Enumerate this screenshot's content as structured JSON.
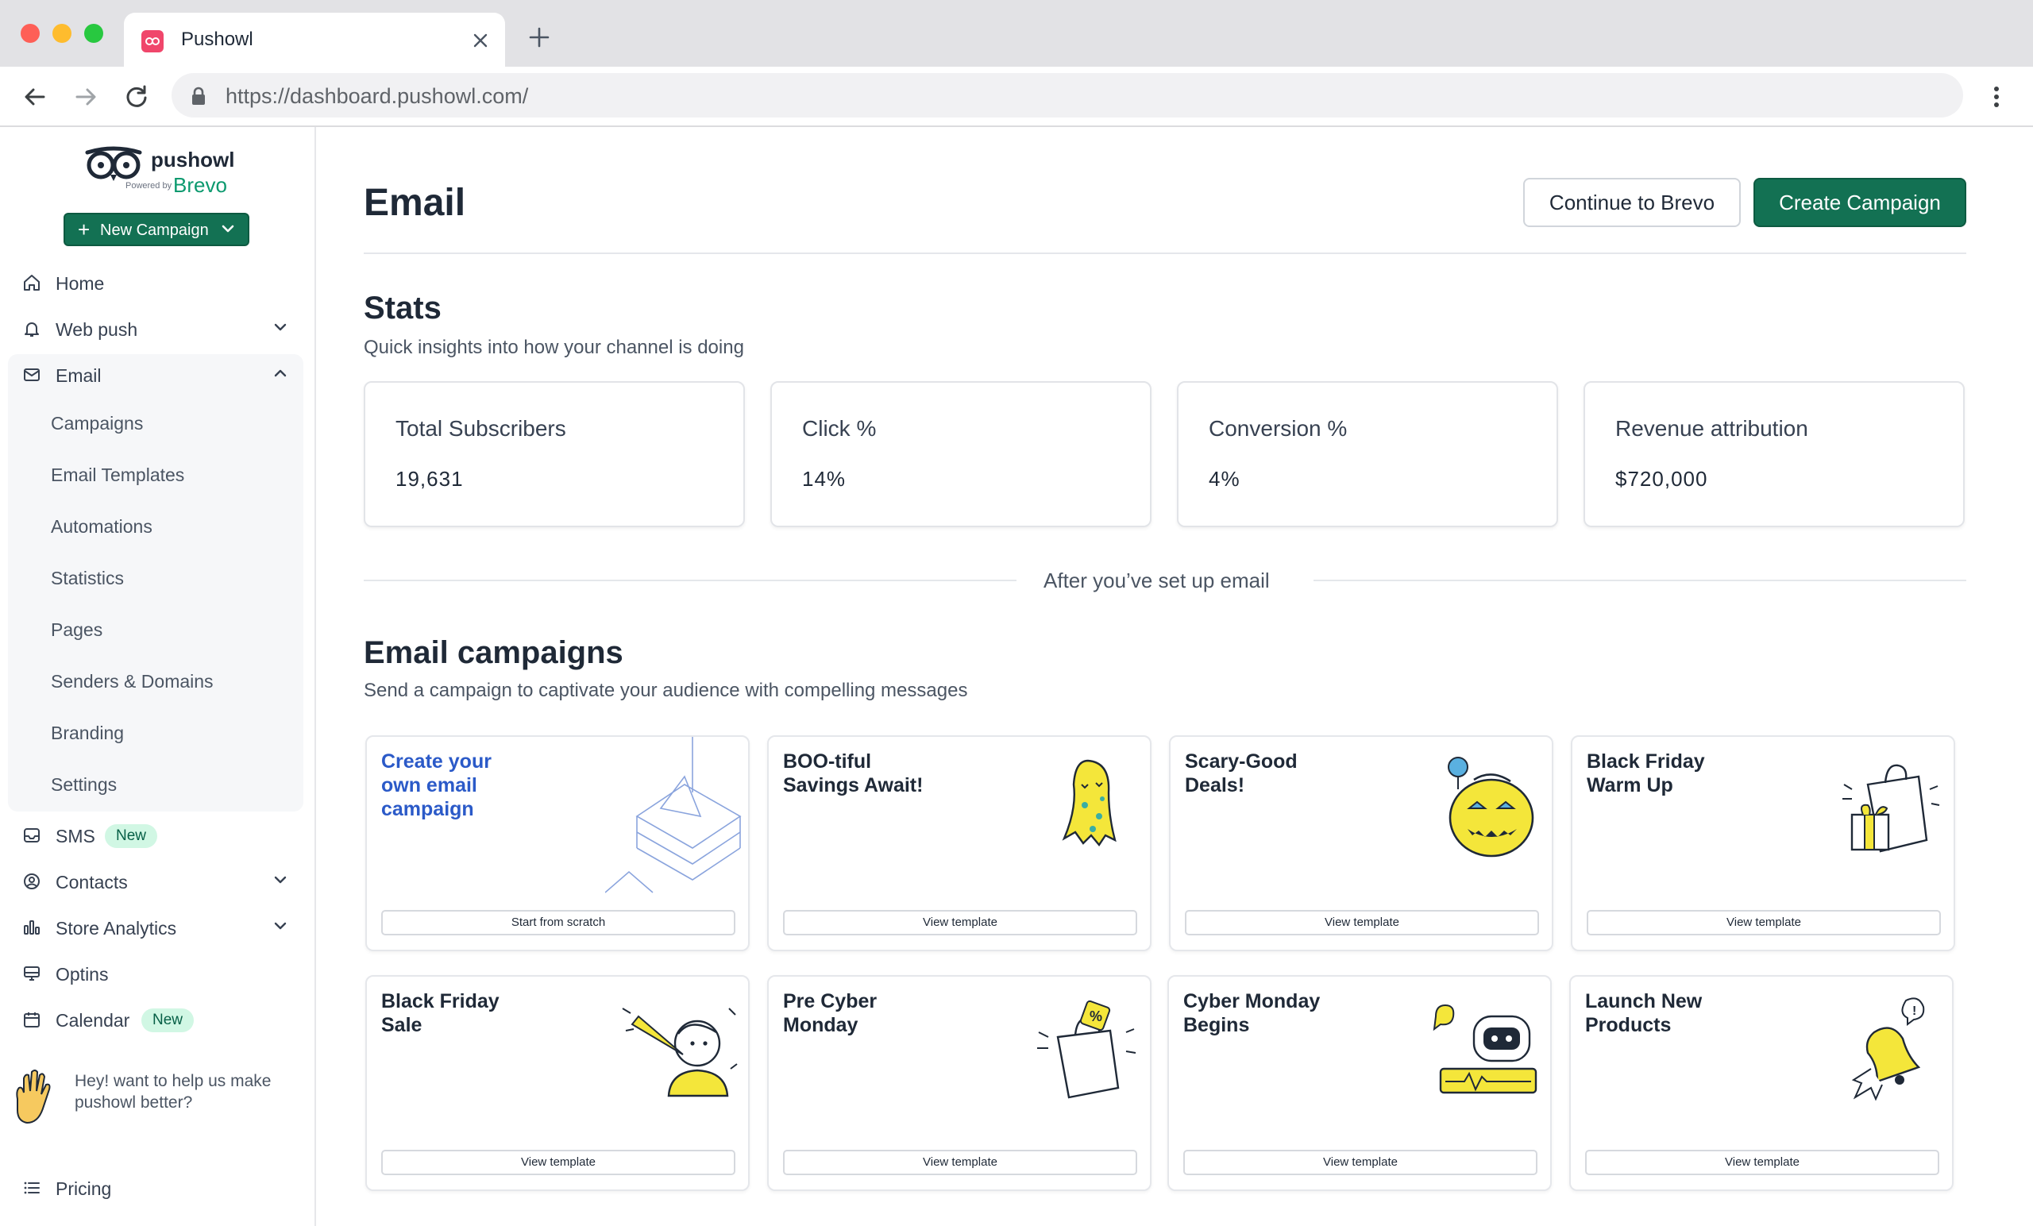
{
  "browser": {
    "tab_title": "Pushowl",
    "url": "https://dashboard.pushowl.com/"
  },
  "logo": {
    "word": "pushowl",
    "powered": "Powered by",
    "brevo": "Brevo"
  },
  "sidebar": {
    "new_campaign": "New Campaign",
    "items": {
      "home": "Home",
      "web_push": "Web push",
      "email": "Email",
      "sms": "SMS",
      "contacts": "Contacts",
      "store_analytics": "Store Analytics",
      "optins": "Optins",
      "calendar": "Calendar",
      "pricing": "Pricing"
    },
    "email_sub": [
      "Campaigns",
      "Email Templates",
      "Automations",
      "Statistics",
      "Pages",
      "Senders & Domains",
      "Branding",
      "Settings"
    ],
    "badge_new": "New",
    "feedback": "Hey! want to help us make pushowl better?"
  },
  "header": {
    "title": "Email",
    "continue_btn": "Continue to Brevo",
    "create_btn": "Create Campaign"
  },
  "stats": {
    "title": "Stats",
    "subtitle": "Quick insights into how your channel is doing",
    "cards": [
      {
        "label": "Total Subscribers",
        "value": "19,631"
      },
      {
        "label": "Click %",
        "value": "14%"
      },
      {
        "label": "Conversion %",
        "value": "4%"
      },
      {
        "label": "Revenue attribution",
        "value": "$720,000"
      }
    ]
  },
  "divider_text": "After you’ve set up email",
  "campaigns": {
    "title": "Email campaigns",
    "subtitle": "Send a campaign to captivate your audience with compelling messages",
    "cards": [
      {
        "title": "Create your\nown email\ncampaign",
        "button": "Start from scratch"
      },
      {
        "title": "BOO-tiful\nSavings Await!",
        "button": "View template"
      },
      {
        "title": "Scary-Good\nDeals!",
        "button": "View template"
      },
      {
        "title": "Black Friday\nWarm Up",
        "button": "View template"
      },
      {
        "title": "Black Friday\nSale",
        "button": "View template"
      },
      {
        "title": "Pre Cyber\nMonday",
        "button": "View template"
      },
      {
        "title": "Cyber Monday\nBegins",
        "button": "View template"
      },
      {
        "title": "Launch New\nProducts",
        "button": "View template"
      }
    ]
  }
}
